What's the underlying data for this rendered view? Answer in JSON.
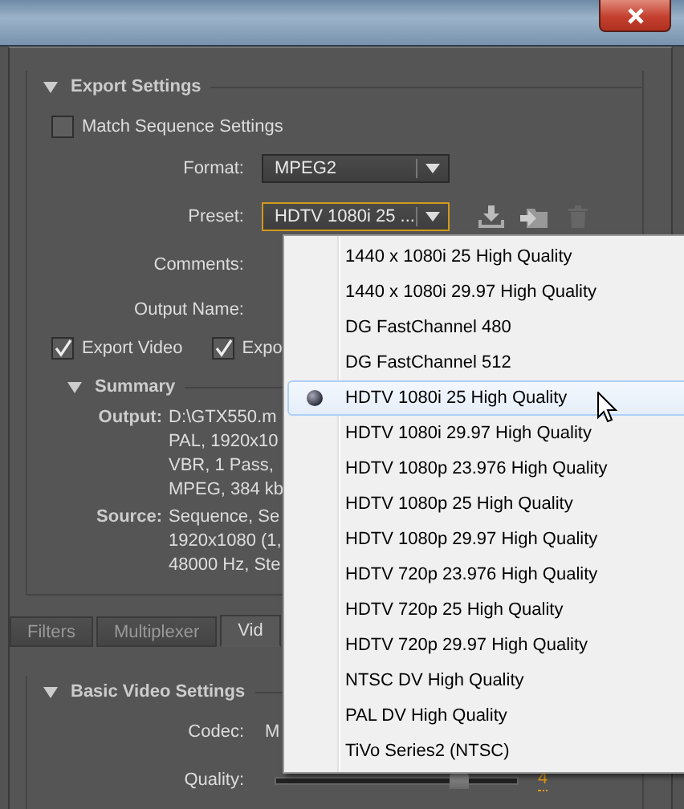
{
  "export_settings": {
    "title": "Export Settings",
    "match_sequence": {
      "label": "Match Sequence Settings",
      "checked": false
    },
    "format": {
      "label": "Format:",
      "value": "MPEG2"
    },
    "preset": {
      "label": "Preset:",
      "value": "HDTV 1080i 25 ..."
    },
    "comments": {
      "label": "Comments:"
    },
    "output_name": {
      "label": "Output Name:"
    },
    "export_video": {
      "label": "Export Video",
      "checked": true
    },
    "export_audio": {
      "label": "Expo",
      "checked": true
    },
    "summary": {
      "title": "Summary",
      "expanded": true,
      "groups": [
        {
          "label": "Output:",
          "lines": [
            "D:\\GTX550.m",
            "PAL, 1920x10",
            "VBR, 1 Pass,",
            "MPEG, 384 kb"
          ]
        },
        {
          "label": "Source:",
          "lines": [
            "Sequence, Se",
            "1920x1080 (1,",
            "48000 Hz, Ste"
          ]
        }
      ]
    }
  },
  "tabs": [
    {
      "label": "Filters",
      "selected": false
    },
    {
      "label": "Multiplexer",
      "selected": false
    },
    {
      "label": "Vid",
      "selected": true
    }
  ],
  "basic_video": {
    "title": "Basic Video Settings",
    "codec": {
      "label": "Codec:",
      "value": "M"
    },
    "quality": {
      "label": "Quality:",
      "level": 0.76,
      "reading": "4"
    }
  },
  "preset_menu": {
    "items": [
      {
        "label": "1440 x 1080i 25 High Quality",
        "selected": false
      },
      {
        "label": "1440 x 1080i 29.97 High Quality",
        "selected": false
      },
      {
        "label": "DG FastChannel 480",
        "selected": false
      },
      {
        "label": "DG FastChannel 512",
        "selected": false
      },
      {
        "label": "HDTV 1080i 25 High Quality",
        "selected": true
      },
      {
        "label": "HDTV 1080i 29.97 High Quality",
        "selected": false
      },
      {
        "label": "HDTV 1080p 23.976 High Quality",
        "selected": false
      },
      {
        "label": "HDTV 1080p 25 High Quality",
        "selected": false
      },
      {
        "label": "HDTV 1080p 29.97 High Quality",
        "selected": false
      },
      {
        "label": "HDTV 720p 23.976 High Quality",
        "selected": false
      },
      {
        "label": "HDTV 720p 25 High Quality",
        "selected": false
      },
      {
        "label": "HDTV 720p 29.97 High Quality",
        "selected": false
      },
      {
        "label": "NTSC DV High Quality",
        "selected": false
      },
      {
        "label": "PAL DV High Quality",
        "selected": false
      },
      {
        "label": "TiVo Series2 (NTSC)",
        "selected": false
      }
    ]
  }
}
